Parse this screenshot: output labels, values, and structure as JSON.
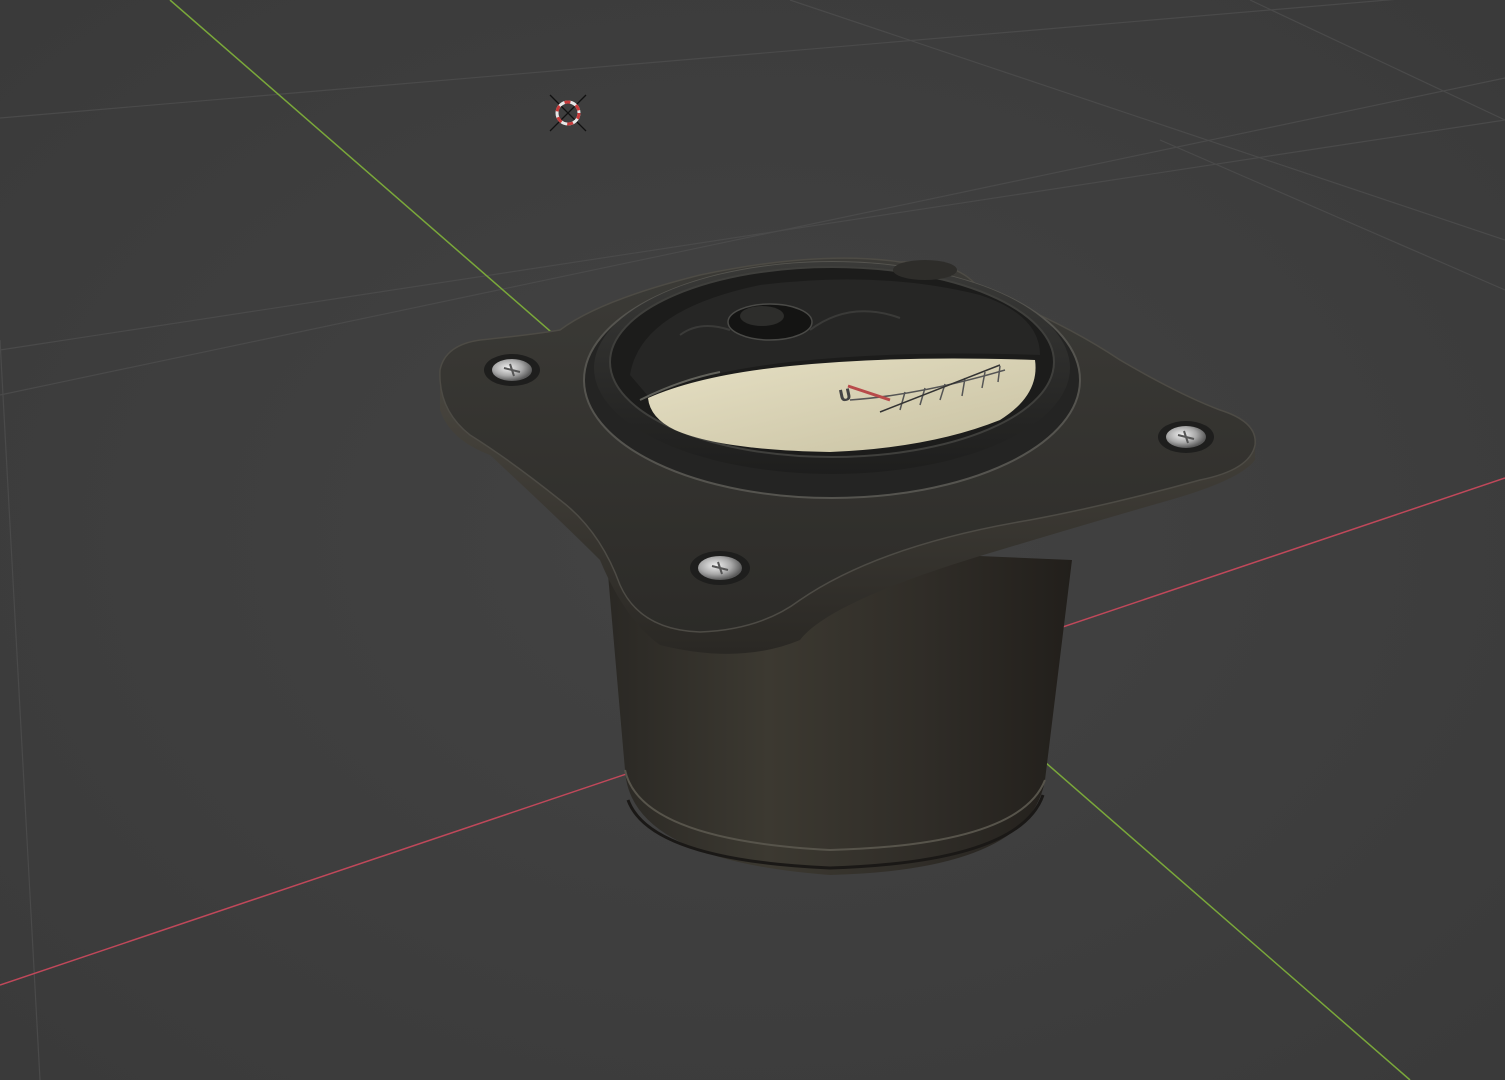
{
  "viewport": {
    "background": "#3d3d3d",
    "grid_color": "#4a4a4a",
    "x_axis_color": "#c0485a",
    "y_axis_color": "#7aa83a"
  },
  "scene_object": {
    "dial_label": "U"
  },
  "icons": {
    "cursor": "3d-cursor-icon"
  }
}
